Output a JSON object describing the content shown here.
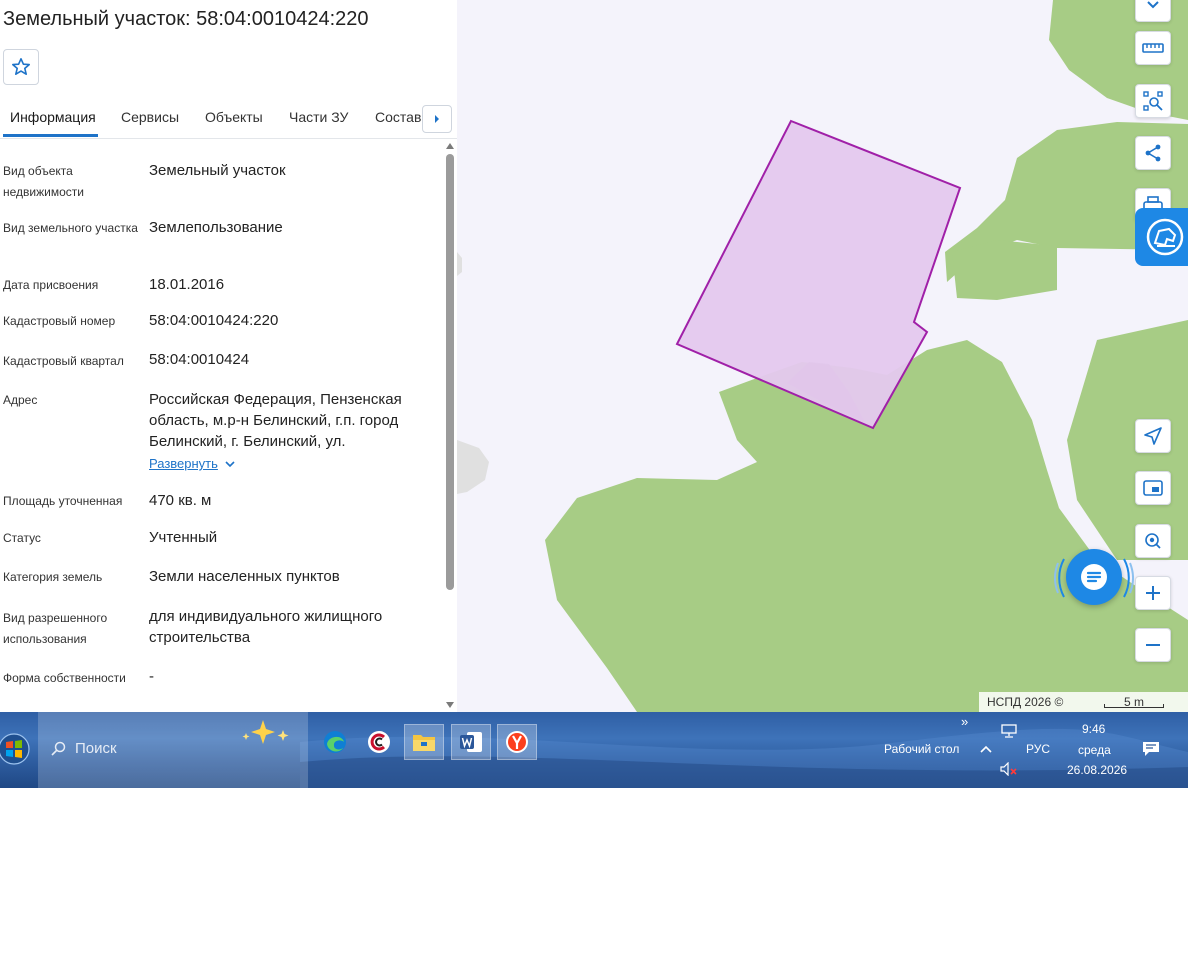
{
  "panel": {
    "title": "Земельный участок: 58:04:0010424:220",
    "tabs": [
      {
        "label": "Информация"
      },
      {
        "label": "Сервисы"
      },
      {
        "label": "Объекты"
      },
      {
        "label": "Части ЗУ"
      },
      {
        "label": "Состав"
      }
    ],
    "fields": [
      {
        "label": "Вид объекта недвижимости",
        "value": "Земельный участок"
      },
      {
        "label": "Вид земельного участка",
        "value": "Землепользование"
      },
      {
        "label": "Дата присвоения",
        "value": "18.01.2016"
      },
      {
        "label": "Кадастровый номер",
        "value": "58:04:0010424:220"
      },
      {
        "label": "Кадастровый квартал",
        "value": "58:04:0010424"
      },
      {
        "label": "Адрес",
        "value": "Российская Федерация, Пензенская область, м.р-н Белинский, г.п. город Белинский, г. Белинский, ул."
      },
      {
        "label": "Площадь уточненная",
        "value": "470 кв. м"
      },
      {
        "label": "Статус",
        "value": "Учтенный"
      },
      {
        "label": "Категория земель",
        "value": "Земли населенных пунктов"
      },
      {
        "label": "Вид разрешенного использования",
        "value": "для индивидуального жилищного строительства"
      },
      {
        "label": "Форма собственности",
        "value": "-"
      }
    ],
    "expand_label": "Развернуть"
  },
  "map": {
    "attribution": "НСПД 2026 ©",
    "scale_label": "5 m",
    "parcel_color": "#e4c8ee",
    "parcel_stroke": "#a020a8",
    "vegetation_color": "#a7cc85",
    "accent": "#1e88e5"
  },
  "taskbar": {
    "search_placeholder": "Поиск",
    "desktop_label": "Рабочий стол",
    "language": "РУС",
    "time": "9:46",
    "weekday": "среда",
    "date": "26.08.2026",
    "overflow_glyph": "»"
  }
}
